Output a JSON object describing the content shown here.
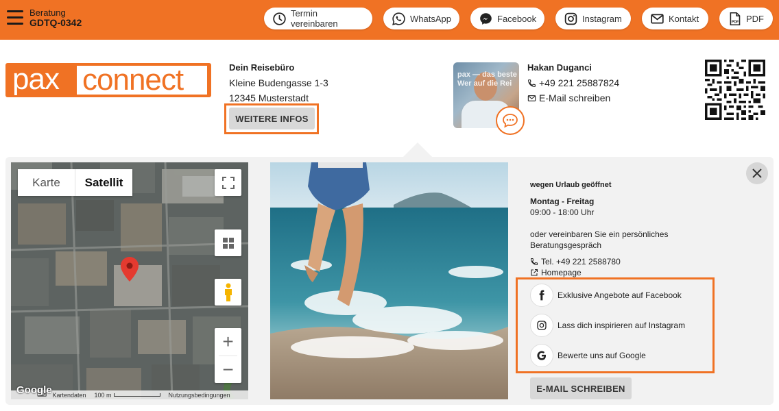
{
  "header": {
    "beratung_label": "Beratung",
    "beratung_code": "GDTQ-0342",
    "buttons": [
      {
        "label": "Termin vereinbaren",
        "icon": "clock-icon"
      },
      {
        "label": "WhatsApp",
        "icon": "whatsapp-icon"
      },
      {
        "label": "Facebook",
        "icon": "messenger-icon"
      },
      {
        "label": "Instagram",
        "icon": "instagram-icon"
      },
      {
        "label": "Kontakt",
        "icon": "mail-icon"
      },
      {
        "label": "PDF",
        "icon": "pdf-icon"
      }
    ]
  },
  "logo": {
    "part1": "pax",
    "part2": "connect"
  },
  "office": {
    "name": "Dein Reisebüro",
    "street": "Kleine Budengasse 1-3",
    "city": "12345 Musterstadt",
    "more_button": "WEITERE INFOS"
  },
  "agent": {
    "name": "Hakan Duganci",
    "phone": "+49 221 25887824",
    "email_link": "E-Mail schreiben",
    "photo_text": "pax — das beste Wer auf die Rei"
  },
  "map": {
    "tabs": [
      "Karte",
      "Satellit"
    ],
    "active_tab": "Satellit",
    "footer": {
      "map_data": "Kartendaten",
      "scale": "100 m",
      "terms": "Nutzungsbedingungen",
      "google": "Google"
    }
  },
  "info": {
    "status": "wegen Urlaub geöffnet",
    "days": "Montag - Freitag",
    "hours": "09:00 - 18:00 Uhr",
    "note_line1": "oder vereinbaren Sie ein persönliches",
    "note_line2": "Beratungsgespräch",
    "phone": "Tel. +49 221 2588780",
    "homepage": "Homepage"
  },
  "social": [
    {
      "label": "Exklusive Angebote auf Facebook",
      "icon": "facebook-icon"
    },
    {
      "label": "Lass dich inspirieren auf Instagram",
      "icon": "instagram-icon"
    },
    {
      "label": "Bewerte uns auf Google",
      "icon": "google-icon"
    }
  ],
  "mail_button": "E-MAIL SCHREIBEN",
  "colors": {
    "brand_orange": "#f07224",
    "button_grey": "#d8d8d8",
    "panel_bg": "#f2f2f2"
  }
}
